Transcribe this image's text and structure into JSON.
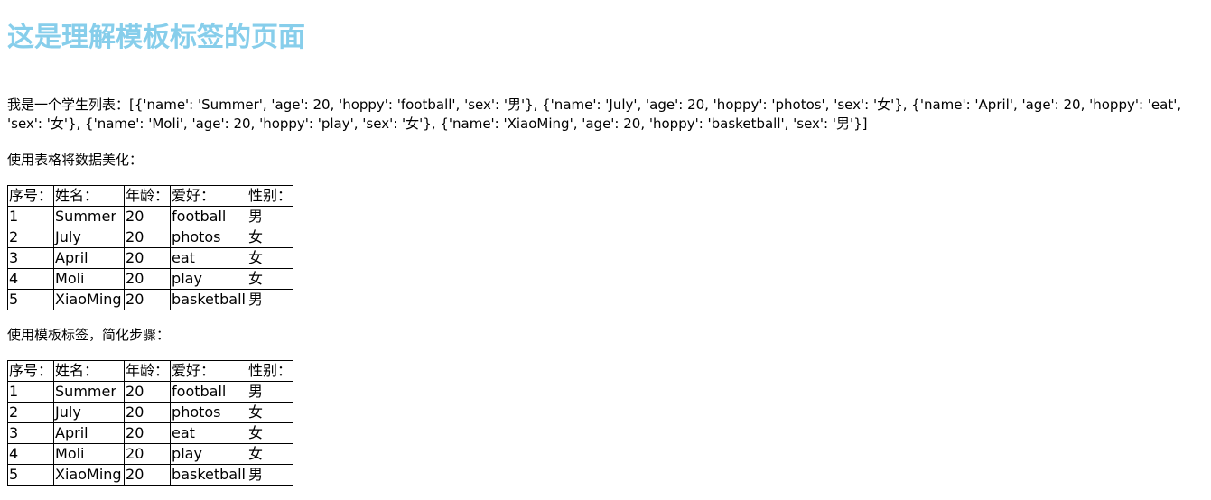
{
  "heading": "这是理解模板标签的页面",
  "student_list_text": "我是一个学生列表：[{'name': 'Summer', 'age': 20, 'hoppy': 'football', 'sex': '男'}, {'name': 'July', 'age': 20, 'hoppy': 'photos', 'sex': '女'}, {'name': 'April', 'age': 20, 'hoppy': 'eat', 'sex': '女'}, {'name': 'Moli', 'age': 20, 'hoppy': 'play', 'sex': '女'}, {'name': 'XiaoMing', 'age': 20, 'hoppy': 'basketball', 'sex': '男'}]",
  "caption_table1": "使用表格将数据美化：",
  "caption_table2": "使用模板标签，简化步骤：",
  "table_headers": [
    "序号：",
    "姓名：",
    "年龄：",
    "爱好：",
    "性别："
  ],
  "students": [
    [
      "1",
      "Summer",
      "20",
      "football",
      "男"
    ],
    [
      "2",
      "July",
      "20",
      "photos",
      "女"
    ],
    [
      "3",
      "April",
      "20",
      "eat",
      "女"
    ],
    [
      "4",
      "Moli",
      "20",
      "play",
      "女"
    ],
    [
      "5",
      "XiaoMing",
      "20",
      "basketball",
      "男"
    ]
  ]
}
